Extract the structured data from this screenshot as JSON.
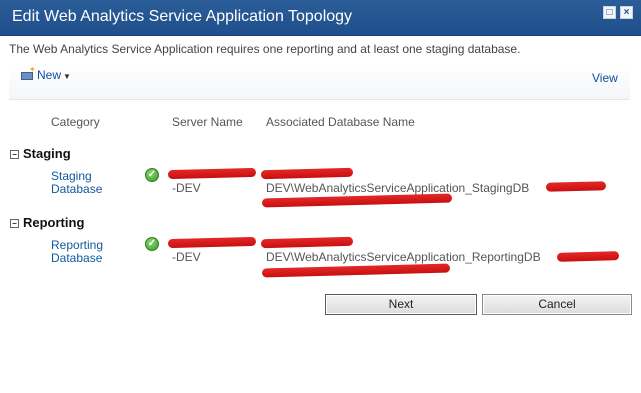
{
  "dialog": {
    "title": "Edit Web Analytics Service Application Topology",
    "intro": "The Web Analytics Service Application requires one reporting and at least one staging database."
  },
  "toolbar": {
    "new_label": "New",
    "view_label": "View"
  },
  "table": {
    "columns": [
      "Category",
      "Server Name",
      "Associated Database Name"
    ],
    "groups": [
      {
        "name": "Staging",
        "row": {
          "category_line1": "Staging",
          "category_line2": "Database",
          "server_suffix": "-DEV",
          "database": "DEV\\WebAnalyticsServiceApplication_StagingDB"
        }
      },
      {
        "name": "Reporting",
        "row": {
          "category_line1": "Reporting",
          "category_line2": "Database",
          "server_suffix": "-DEV",
          "database": "DEV\\WebAnalyticsServiceApplication_ReportingDB"
        }
      }
    ]
  },
  "buttons": {
    "next": "Next",
    "cancel": "Cancel"
  }
}
